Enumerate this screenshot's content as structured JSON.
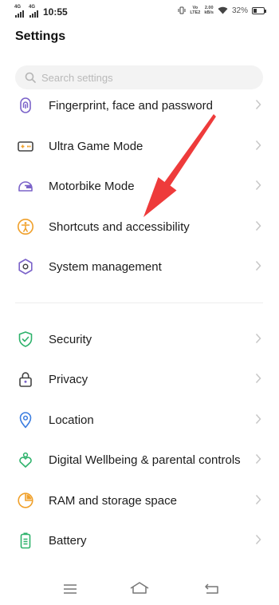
{
  "status_bar": {
    "sim1_label": "4G",
    "sim2_label": "4G",
    "time": "10:55",
    "volte_line1": "Vo",
    "volte_line2": "LTE2",
    "speed_value": "2.00",
    "speed_unit": "kB/s",
    "battery_percent": "32%",
    "battery_level": 0.32
  },
  "header": {
    "title": "Settings"
  },
  "search": {
    "placeholder": "Search settings"
  },
  "items": [
    {
      "label": "Fingerprint, face and password",
      "icon": "fingerprint-icon",
      "color": "#7b63c9"
    },
    {
      "label": "Ultra Game Mode",
      "icon": "gamepad-icon",
      "color": "#f0a02a"
    },
    {
      "label": "Motorbike Mode",
      "icon": "helmet-icon",
      "color": "#7b63c9"
    },
    {
      "label": "Shortcuts and accessibility",
      "icon": "accessibility-icon",
      "color": "#f0a02a"
    },
    {
      "label": "System management",
      "icon": "hexagon-gear-icon",
      "color": "#7b63c9"
    },
    {
      "label": "Security",
      "icon": "shield-check-icon",
      "color": "#2db26b"
    },
    {
      "label": "Privacy",
      "icon": "lock-icon",
      "color": "#7b63c9"
    },
    {
      "label": "Location",
      "icon": "location-pin-icon",
      "color": "#3b7de0"
    },
    {
      "label": "Digital Wellbeing & parental controls",
      "icon": "heart-person-icon",
      "color": "#2db26b"
    },
    {
      "label": "RAM and storage space",
      "icon": "pie-chart-icon",
      "color": "#f0a02a"
    },
    {
      "label": "Battery",
      "icon": "battery-icon",
      "color": "#2db26b"
    }
  ],
  "annotation": {
    "color": "#ee3b3b"
  }
}
